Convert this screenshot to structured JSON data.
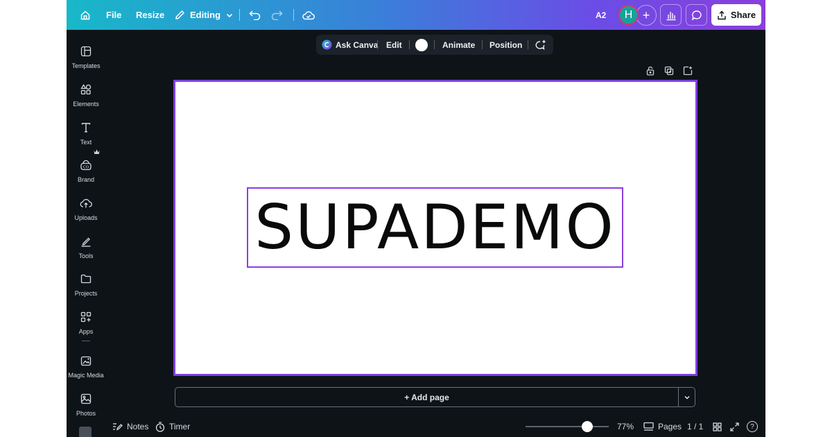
{
  "topbar": {
    "file_label": "File",
    "resize_label": "Resize",
    "editing_label": "Editing",
    "page_size": "A2",
    "avatar_initial": "H",
    "share_label": "Share",
    "gradient_colors": [
      "#18b8c9",
      "#3a7fd9",
      "#6a4de6",
      "#8a3fdc"
    ]
  },
  "sidebar": {
    "items": [
      {
        "label": "Templates",
        "icon": "templates-icon"
      },
      {
        "label": "Elements",
        "icon": "elements-icon"
      },
      {
        "label": "Text",
        "icon": "text-icon"
      },
      {
        "label": "Brand",
        "icon": "brand-icon"
      },
      {
        "label": "Uploads",
        "icon": "uploads-icon"
      },
      {
        "label": "Tools",
        "icon": "tools-icon"
      },
      {
        "label": "Projects",
        "icon": "projects-icon"
      },
      {
        "label": "Apps",
        "icon": "apps-icon"
      },
      {
        "label": "Magic Media",
        "icon": "magic-media-icon"
      },
      {
        "label": "Photos",
        "icon": "photos-icon"
      }
    ]
  },
  "context_toolbar": {
    "ask_label": "Ask Canva",
    "edit_label": "Edit",
    "text_color": "#ffffff",
    "animate_label": "Animate",
    "position_label": "Position"
  },
  "canvas": {
    "text": "SUPADEMO",
    "selection_color": "#8b3fe0",
    "add_page_label": "+ Add page"
  },
  "bottombar": {
    "notes_label": "Notes",
    "timer_label": "Timer",
    "zoom_value": 0.77,
    "zoom_label": "77%",
    "pages_label": "Pages",
    "page_count": "1 / 1",
    "help_label": "?"
  }
}
